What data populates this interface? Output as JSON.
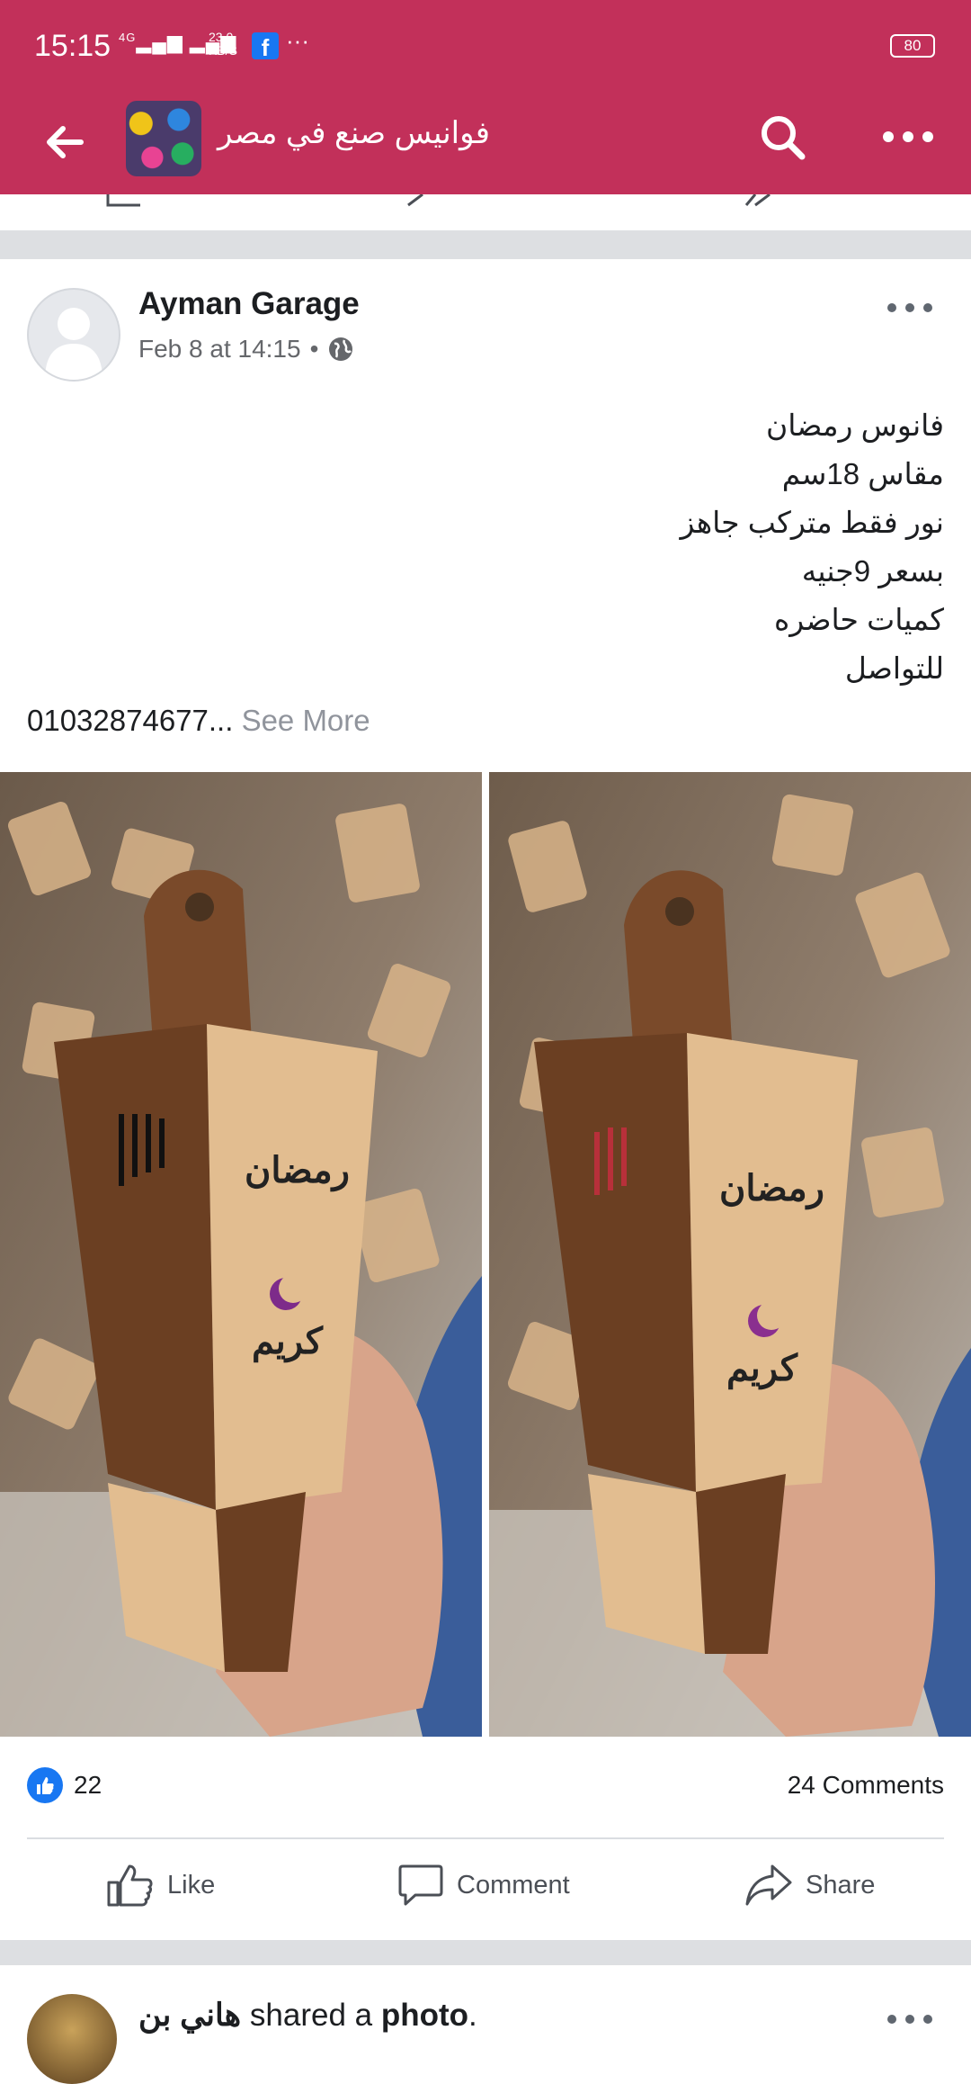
{
  "status_bar": {
    "time": "15:15",
    "network": "4G",
    "speed_top": "23.0",
    "speed_unit": "KB/S",
    "more": "···",
    "battery": "80",
    "fb_icon": "facebook-icon"
  },
  "header": {
    "title": "فوانيس صنع في مصر",
    "back_icon": "back-arrow-icon",
    "search_icon": "search-icon",
    "more_icon": "more-icon",
    "color": "#c2305a"
  },
  "post": {
    "author": "Ayman Garage",
    "time": "Feb 8 at 14:15",
    "separator": "•",
    "privacy_icon": "globe-icon",
    "text_lines": [
      "فانوس رمضان",
      "مقاس 18سم",
      "نور فقط متركب جاهز",
      "بسعر 9جنيه",
      "كميات حاضره",
      "للتواصل"
    ],
    "phone": "01032874677...",
    "see_more": "See More",
    "photos": [
      {
        "caption_top": "رمضان",
        "caption_bottom": "كريم"
      },
      {
        "caption_top": "رمضان",
        "caption_bottom": "كريم"
      }
    ],
    "reactions_count": "22",
    "comments_count": "24 Comments",
    "actions": {
      "like": "Like",
      "comment": "Comment",
      "share": "Share"
    }
  },
  "next_post": {
    "author": "هاني بن",
    "shared_text": "shared a",
    "photo_word": "photo",
    "period": "."
  }
}
